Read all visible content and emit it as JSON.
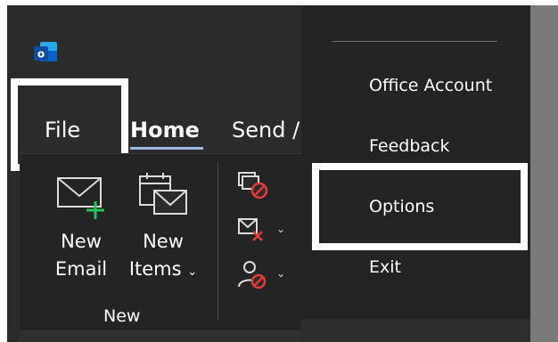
{
  "app": {
    "icon": "outlook-icon"
  },
  "tabs": [
    {
      "label": "File"
    },
    {
      "label": "Home"
    },
    {
      "label": "Send /"
    }
  ],
  "ribbon": {
    "new_email": {
      "line1": "New",
      "line2": "Email",
      "icon": "new-email-icon"
    },
    "new_items": {
      "line1": "New",
      "line2": "Items",
      "icon": "new-items-icon"
    },
    "group_label": "New",
    "small_buttons": [
      {
        "icon": "ignore-icon"
      },
      {
        "icon": "delete-clean-up-icon"
      },
      {
        "icon": "block-sender-icon"
      }
    ]
  },
  "file_menu": {
    "items": [
      {
        "label": "Office Account"
      },
      {
        "label": "Feedback"
      },
      {
        "label": "Options"
      },
      {
        "label": "Exit"
      }
    ]
  },
  "colors": {
    "background": "#2b2b2b",
    "menu_background": "#232323",
    "highlight": "#ffffff",
    "outlook_blue": "#0a64c6",
    "accent_green": "#21c35a",
    "accent_red": "#e5393a"
  }
}
